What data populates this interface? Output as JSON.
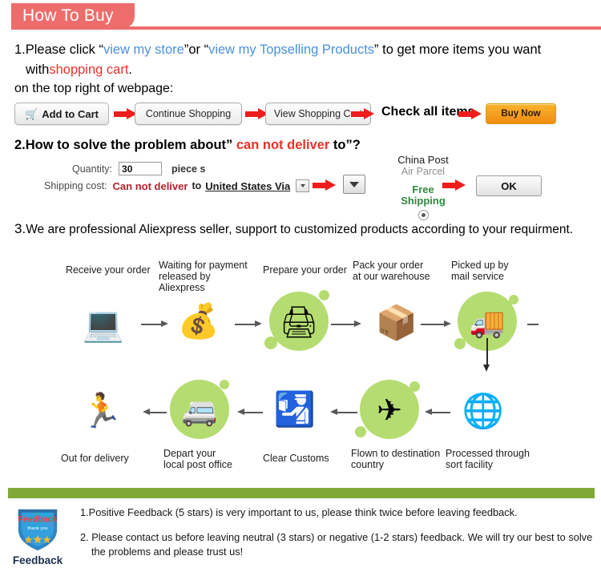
{
  "header": {
    "title": "How To Buy",
    "accent": "#ef6c6c"
  },
  "section1": {
    "number": "1.",
    "text_before": "Please click “",
    "link1": "view my store",
    "text_mid": "”or “",
    "link2": "view my Topselling Products",
    "text_after": "” to get  more items you want",
    "line2_before": "with ",
    "line2_highlight": "shopping cart",
    "line2_after": ".",
    "subline": "on the top right of webpage:"
  },
  "buttons": {
    "add_to_cart": "Add to Cart",
    "cart_icon": "cart-icon",
    "continue_shopping": "Continue Shopping",
    "view_shopping_cart": "View Shopping Cart",
    "check_all_items": "Check all items",
    "buy_now": "Buy Now"
  },
  "section2": {
    "number": "2.",
    "text_before": "How to solve the problem about” ",
    "highlight": "can not deliver",
    "text_after": " to”?",
    "quantity_label": "Quantity:",
    "quantity_value": "30",
    "quantity_unit": "piece s",
    "shipping_label": "Shipping cost:",
    "shipping_status": "Can not deliver",
    "shipping_to": "to",
    "shipping_country": "United States Via",
    "post_name": "China Post",
    "post_sub": "Air Parcel",
    "free_shipping_l1": "Free",
    "free_shipping_l2": "Shipping",
    "ok_button": "OK"
  },
  "section3": {
    "number": "3.",
    "text": "We are professional Aliexpress seller, support to customized products according to your requirment."
  },
  "flow": {
    "top_row": [
      {
        "label": "Receive your order",
        "icon": "person-at-computer-icon",
        "blob": false,
        "emoji": "💻"
      },
      {
        "label": "Waiting for payment\nreleased by Aliexpress",
        "icon": "money-bag-icon",
        "blob": false,
        "emoji": "💰"
      },
      {
        "label": "Prepare your order",
        "icon": "printer-icon",
        "blob": true,
        "emoji": "🖨"
      },
      {
        "label": "Pack your order\nat our warehouse",
        "icon": "worker-packing-boxes-icon",
        "blob": false,
        "emoji": "📦"
      },
      {
        "label": "Picked up by\nmail service",
        "icon": "mail-truck-icon",
        "blob": true,
        "emoji": "🚚"
      }
    ],
    "bottom_row": [
      {
        "label": "Out for delivery",
        "icon": "delivery-courier-running-icon",
        "blob": false,
        "emoji": "🏃"
      },
      {
        "label": "Depart your\nlocal post office",
        "icon": "delivery-van-icon",
        "blob": true,
        "emoji": "🚐"
      },
      {
        "label": "Clear Customs",
        "icon": "customs-officer-icon",
        "blob": false,
        "emoji": "🛂"
      },
      {
        "label": "Flown to destination\ncountry",
        "icon": "airplane-icon",
        "blob": true,
        "emoji": "✈"
      },
      {
        "label": "Processed through\nsort facility",
        "icon": "global-mail-sorting-icon",
        "blob": false,
        "emoji": "🌐"
      }
    ],
    "blob_color": "#b5dc70"
  },
  "footer": {
    "bar_color": "#7fa938",
    "badge_caption": "Feedback",
    "badge_title": "Feedback",
    "badge_sub": "thank you",
    "line1": "1.Positive Feedback (5 stars) is very important to us, please think twice before leaving feedback.",
    "line2": "2. Please contact us before leaving neutral (3 stars) or negative (1-2 stars) feedback. We will try our best to solve",
    "line2b": "the problems and please trust us!"
  }
}
